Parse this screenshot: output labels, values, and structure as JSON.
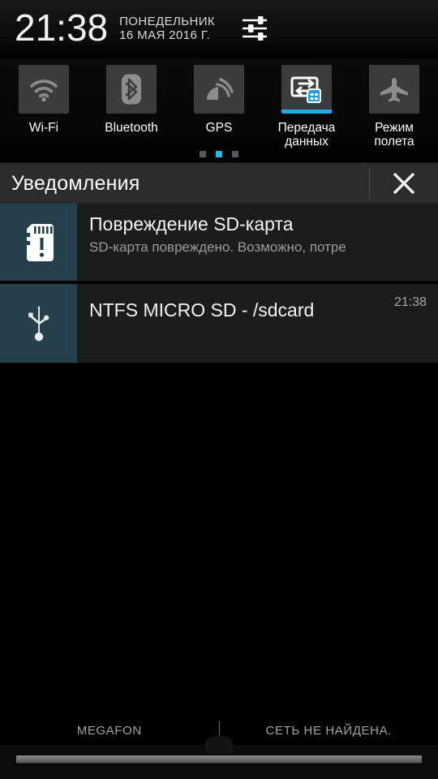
{
  "statusbar": {
    "clock": "21:38",
    "day": "ПОНЕДЕЛЬНИК",
    "date": "16 МАЯ 2016 Г.",
    "settings_icon": "sliders-settings-icon"
  },
  "quick_settings": {
    "toggles": [
      {
        "label": "Wi-Fi",
        "icon": "wifi-icon",
        "active": false
      },
      {
        "label": "Bluetooth",
        "icon": "bluetooth-icon",
        "active": false
      },
      {
        "label": "GPS",
        "icon": "gps-satellite-icon",
        "active": false
      },
      {
        "label": "Передача данных",
        "icon": "data-transfer-icon",
        "active": true
      },
      {
        "label": "Режим полета",
        "icon": "airplane-icon",
        "active": false
      }
    ],
    "pages": 3,
    "active_page": 2,
    "active_accent": "#22a9e0"
  },
  "notifications_panel": {
    "title": "Уведомления",
    "close_label": "✕",
    "close_icon": "close-x-icon",
    "items": [
      {
        "icon": "sd-card-warning-icon",
        "title": "Повреждение SD-карта",
        "subtitle": "SD-карта повреждено. Возможно, потре",
        "time": ""
      },
      {
        "icon": "usb-icon",
        "title": "NTFS MICRO SD - /sdcard",
        "subtitle": "",
        "time": "21:38"
      }
    ],
    "icon_panel_color": "#25404b"
  },
  "bottom_bar": {
    "carrier_left": "MEGAFON",
    "carrier_right": "СЕТЬ НЕ НАЙДЕНА."
  }
}
